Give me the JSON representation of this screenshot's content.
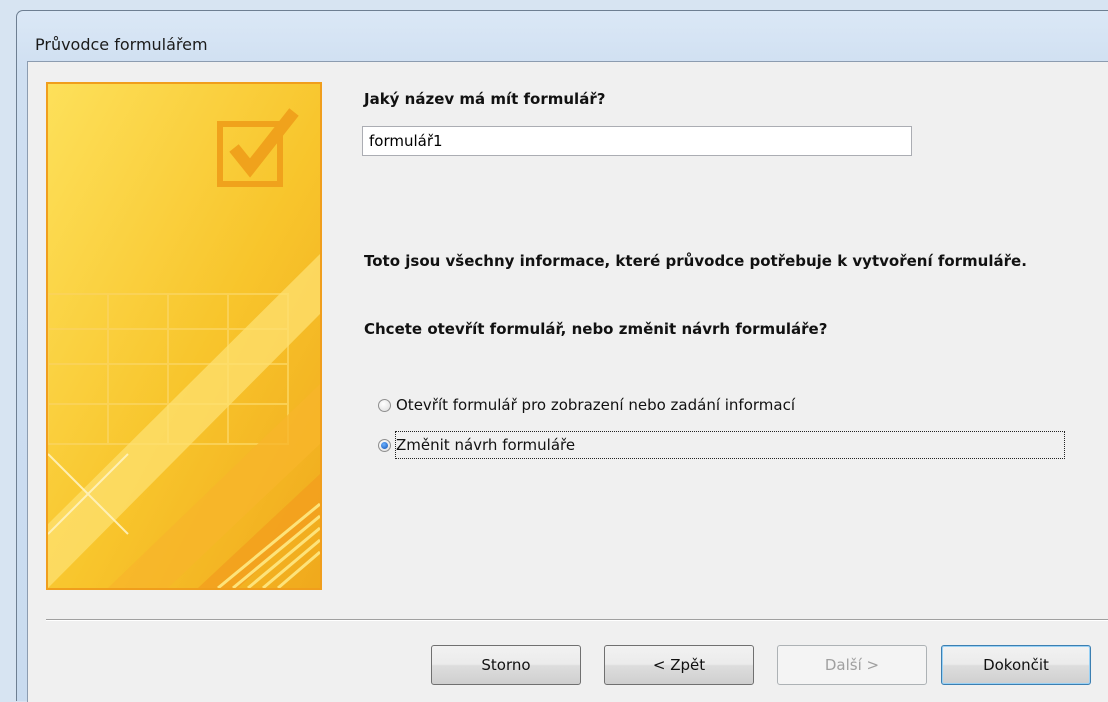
{
  "window": {
    "title": "Průvodce formulářem"
  },
  "form": {
    "name_question": "Jaký název má mít formulář?",
    "name_value": "formulář1",
    "info_text": "Toto jsou všechny informace, které průvodce potřebuje k vytvoření formuláře.",
    "open_question": "Chcete otevřít formulář, nebo změnit návrh formuláře?",
    "options": [
      {
        "label": "Otevřít formulář pro zobrazení nebo zadání informací",
        "selected": false
      },
      {
        "label": "Změnit návrh formuláře",
        "selected": true
      }
    ]
  },
  "buttons": {
    "cancel": "Storno",
    "back": "< Zpět",
    "next": "Další >",
    "finish": "Dokončit"
  },
  "icons": {
    "wizard_image": "form-wizard-checkmark-icon"
  },
  "colors": {
    "wizard_yellow": "#f7c62e",
    "wizard_orange": "#f09e1c"
  }
}
